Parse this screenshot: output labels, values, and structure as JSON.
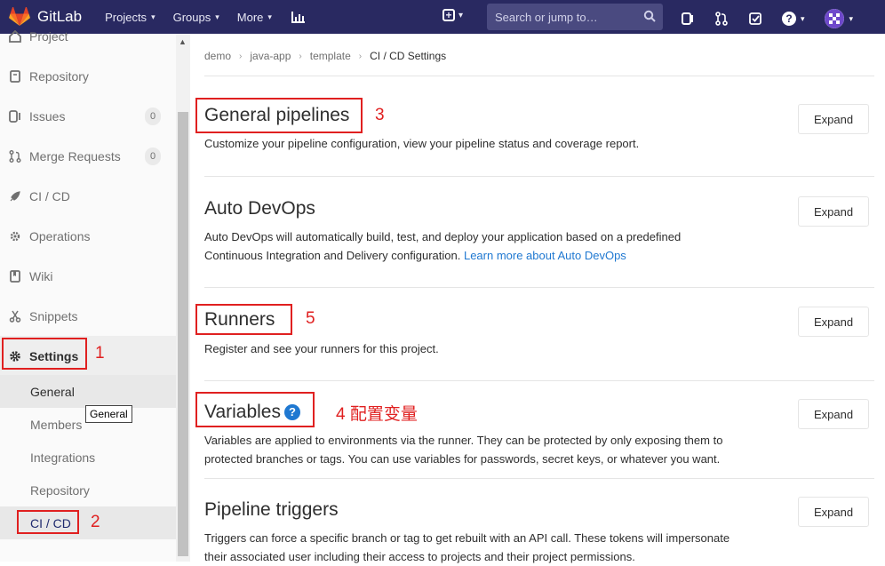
{
  "topbar": {
    "brand": "GitLab",
    "nav": [
      {
        "label": "Projects",
        "caret": "▾"
      },
      {
        "label": "Groups",
        "caret": "▾"
      },
      {
        "label": "More",
        "caret": "▾"
      }
    ],
    "search_placeholder": "Search or jump to…",
    "plus_caret": "▾",
    "help_symbol": "?",
    "help_caret": "▾",
    "avatar_caret": "▾"
  },
  "sidebar": {
    "top_partial": "Project",
    "items": [
      {
        "label": "Repository",
        "icon": "book-icon"
      },
      {
        "label": "Issues",
        "icon": "issues-icon",
        "count": "0"
      },
      {
        "label": "Merge Requests",
        "icon": "merge-request-icon",
        "count": "0"
      },
      {
        "label": "CI / CD",
        "icon": "rocket-icon"
      },
      {
        "label": "Operations",
        "icon": "cloud-gear-icon"
      },
      {
        "label": "Wiki",
        "icon": "wiki-icon"
      },
      {
        "label": "Snippets",
        "icon": "scissors-icon"
      },
      {
        "label": "Settings",
        "icon": "gear-icon",
        "active": true
      }
    ],
    "subitems": [
      {
        "label": "General",
        "highlighted": true
      },
      {
        "label": "Members"
      },
      {
        "label": "Integrations"
      },
      {
        "label": "Repository"
      },
      {
        "label": "CI / CD",
        "current": true
      }
    ],
    "tooltip": "General"
  },
  "breadcrumb": [
    "demo",
    "java-app",
    "template",
    "CI / CD Settings"
  ],
  "breadcrumb_sep": "›",
  "sections": [
    {
      "title": "General pipelines",
      "desc": "Customize your pipeline configuration, view your pipeline status and coverage report.",
      "button": "Expand"
    },
    {
      "title": "Auto DevOps",
      "desc_line1": "Auto DevOps will automatically build, test, and deploy your application based on a predefined",
      "desc_line2": "Continuous Integration and Delivery configuration.",
      "link": "Learn more about Auto DevOps",
      "button": "Expand"
    },
    {
      "title": "Runners",
      "desc": "Register and see your runners for this project.",
      "button": "Expand"
    },
    {
      "title": "Variables",
      "help": "?",
      "desc_line1": "Variables are applied to environments via the runner. They can be protected by only exposing them to",
      "desc_line2": "protected branches or tags. You can use variables for passwords, secret keys, or whatever you want.",
      "button": "Expand"
    },
    {
      "title": "Pipeline triggers",
      "desc_line1": "Triggers can force a specific branch or tag to get rebuilt with an API call. These tokens will impersonate",
      "desc_line2": "their associated user including their access to projects and their project permissions.",
      "button": "Expand"
    }
  ],
  "annotations": {
    "n1": "1",
    "n2": "2",
    "n3": "3",
    "n4": "4 配置变量",
    "n5": "5",
    "color": "#e02020"
  },
  "colors": {
    "nav_bg": "#292961",
    "link": "#1f78d1",
    "annotation": "#e02020"
  }
}
